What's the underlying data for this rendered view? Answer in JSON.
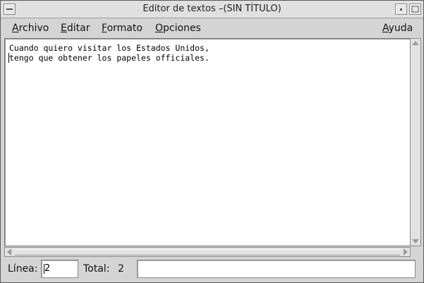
{
  "window": {
    "title": "Editor de textos –(SIN TÍTULO)"
  },
  "menubar": {
    "items": [
      {
        "mnemonic": "A",
        "rest": "rchivo"
      },
      {
        "mnemonic": "E",
        "rest": "ditar"
      },
      {
        "mnemonic": "F",
        "rest": "ormato"
      },
      {
        "mnemonic": "O",
        "rest": "pciones"
      },
      {
        "mnemonic": "A",
        "rest": "yuda"
      }
    ]
  },
  "editor": {
    "lines": [
      "Cuando quiero visitar los Estados Unidos,",
      "tengo que obtener los papeles officiales."
    ]
  },
  "status": {
    "line_label": "Línea:",
    "line_value": "2",
    "total_label": "Total:",
    "total_value": "2",
    "message": ""
  }
}
